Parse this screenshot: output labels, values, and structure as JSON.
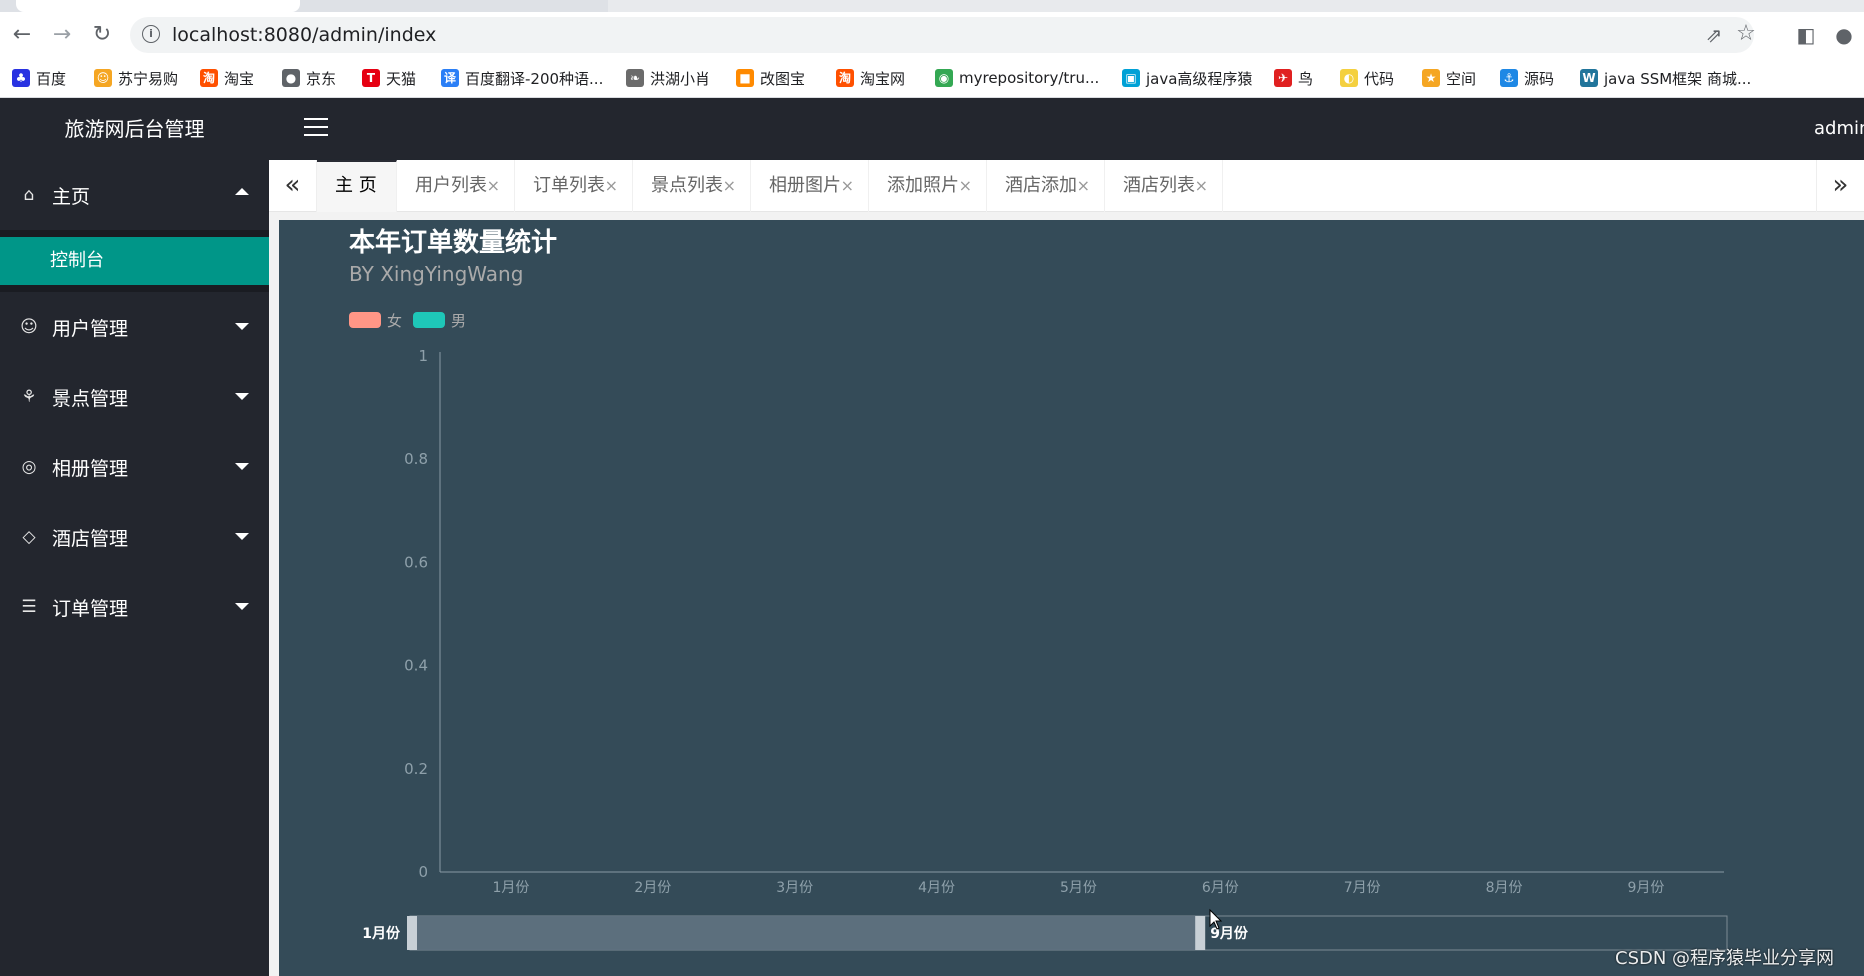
{
  "browser": {
    "url": "localhost:8080/admin/index",
    "bookmarks": [
      {
        "label": "百度",
        "icon": "baidu-icon",
        "color": "#2932e1"
      },
      {
        "label": "苏宁易购",
        "icon": "suning-icon",
        "color": "#f5a623"
      },
      {
        "label": "淘宝",
        "icon": "taobao-icon",
        "color": "#ff5000"
      },
      {
        "label": "京东",
        "icon": "globe-icon",
        "color": "#5f6368"
      },
      {
        "label": "天猫",
        "icon": "tmall-icon",
        "color": "#e60012"
      },
      {
        "label": "百度翻译-200种语...",
        "icon": "translate-icon",
        "color": "#2b7ff6"
      },
      {
        "label": "洪湖小肖",
        "icon": "feather-icon",
        "color": "#6b6b6b"
      },
      {
        "label": "改图宝",
        "icon": "gaitubao-icon",
        "color": "#ff8a00"
      },
      {
        "label": "淘宝网",
        "icon": "taobao-icon",
        "color": "#ff5000"
      },
      {
        "label": "myrepository/tru...",
        "icon": "chrome-icon",
        "color": "#34a853"
      },
      {
        "label": "java高级程序猿",
        "icon": "bilibili-icon",
        "color": "#00a1d6"
      },
      {
        "label": "鸟",
        "icon": "bird-icon",
        "color": "#e02020"
      },
      {
        "label": "代码",
        "icon": "code-icon",
        "color": "#f4d03f"
      },
      {
        "label": "空间",
        "icon": "qzone-icon",
        "color": "#f5a623"
      },
      {
        "label": "源码",
        "icon": "docker-icon",
        "color": "#1e88e5"
      },
      {
        "label": "java SSM框架 商城...",
        "icon": "wordpress-icon",
        "color": "#21759b"
      }
    ]
  },
  "header": {
    "brand": "旅游网后台管理",
    "user": "admin"
  },
  "sidebar": {
    "items": [
      {
        "label": "主页",
        "icon": "home-icon",
        "expanded": true
      },
      {
        "label": "用户管理",
        "icon": "user-icon",
        "expanded": false
      },
      {
        "label": "景点管理",
        "icon": "palm-tree-icon",
        "expanded": false
      },
      {
        "label": "相册管理",
        "icon": "camera-icon",
        "expanded": false
      },
      {
        "label": "酒店管理",
        "icon": "diamond-icon",
        "expanded": false
      },
      {
        "label": "订单管理",
        "icon": "list-icon",
        "expanded": false
      }
    ],
    "subitem": "控制台"
  },
  "tabs": [
    {
      "label": "主 页",
      "active": true,
      "closable": false
    },
    {
      "label": "用户列表",
      "active": false,
      "closable": true
    },
    {
      "label": "订单列表",
      "active": false,
      "closable": true
    },
    {
      "label": "景点列表",
      "active": false,
      "closable": true
    },
    {
      "label": "相册图片",
      "active": false,
      "closable": true
    },
    {
      "label": "添加照片",
      "active": false,
      "closable": true
    },
    {
      "label": "酒店添加",
      "active": false,
      "closable": true
    },
    {
      "label": "酒店列表",
      "active": false,
      "closable": true
    }
  ],
  "chart_data": {
    "type": "bar",
    "title": "本年订单数量统计",
    "subtitle": "BY XingYingWang",
    "categories": [
      "1月份",
      "2月份",
      "3月份",
      "4月份",
      "5月份",
      "6月份",
      "7月份",
      "8月份",
      "9月份"
    ],
    "series": [
      {
        "name": "女",
        "color": "#ff9686",
        "values": [
          0,
          0,
          0,
          0,
          0,
          0,
          0,
          0,
          0
        ]
      },
      {
        "name": "男",
        "color": "#1ec7b8",
        "values": [
          0,
          0,
          0,
          0,
          0,
          0,
          0,
          0,
          0
        ]
      }
    ],
    "y_ticks": [
      "0",
      "0.2",
      "0.4",
      "0.6",
      "0.8",
      "1"
    ],
    "ylim": [
      0,
      1
    ],
    "legend_position": "top-left",
    "background": "#344b58",
    "data_zoom": {
      "start_label": "1月份",
      "end_label": "9月份",
      "start": 0,
      "end": 0.6
    }
  },
  "watermark": "CSDN @程序猿毕业分享网"
}
